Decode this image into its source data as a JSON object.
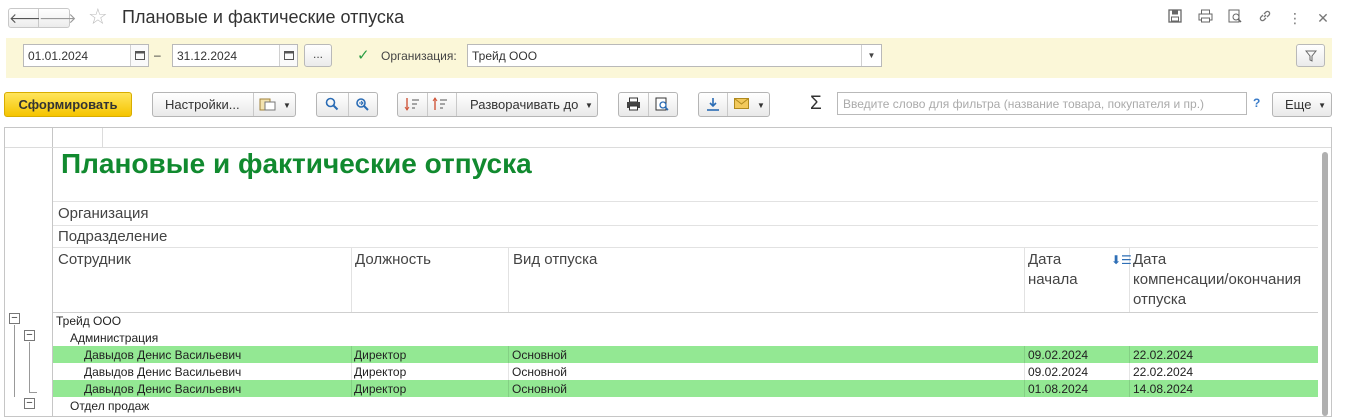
{
  "window": {
    "title": "Плановые и фактические отпуска",
    "back_glyph": "🡐",
    "forward_glyph": "🡒",
    "icons": [
      "save-icon",
      "print-icon",
      "preview-icon",
      "link-icon",
      "more-vertical-icon",
      "close-icon"
    ]
  },
  "filters": {
    "date_from": "01.01.2024",
    "date_to": "31.12.2024",
    "dash": "–",
    "period_button": "...",
    "org_checked": true,
    "org_label": "Организация:",
    "org_value": "Трейд ООО"
  },
  "toolbar": {
    "generate": "Сформировать",
    "settings": "Настройки...",
    "expand_to": "Разворачивать до",
    "search_placeholder": "Введите слово для фильтра (название товара, покупателя и пр.)",
    "help": "?",
    "more": "Еще"
  },
  "report": {
    "title": "Плановые и фактические отпуска",
    "group_headers": [
      "Организация",
      "Подразделение"
    ],
    "columns": {
      "employee": "Сотрудник",
      "position": "Должность",
      "leave_type": "Вид отпуска",
      "start_date_l1": "Дата",
      "start_date_l2": "начала",
      "end_date_l1": "Дата",
      "end_date_l2": "компенсации/окончания",
      "end_date_l3": "отпуска"
    },
    "org_row": "Трейд ООО",
    "dept_rows": [
      "Администрация",
      "Отдел продаж"
    ],
    "rows": [
      {
        "employee": "Давыдов Денис Васильевич",
        "position": "Директор",
        "leave_type": "Основной",
        "start": "09.02.2024",
        "end": "22.02.2024",
        "highlight": true
      },
      {
        "employee": "Давыдов Денис Васильевич",
        "position": "Директор",
        "leave_type": "Основной",
        "start": "09.02.2024",
        "end": "22.02.2024",
        "highlight": false
      },
      {
        "employee": "Давыдов Денис Васильевич",
        "position": "Директор",
        "leave_type": "Основной",
        "start": "01.08.2024",
        "end": "14.08.2024",
        "highlight": true
      }
    ],
    "highlight_color": "#93e893",
    "title_color": "#118a2f"
  }
}
